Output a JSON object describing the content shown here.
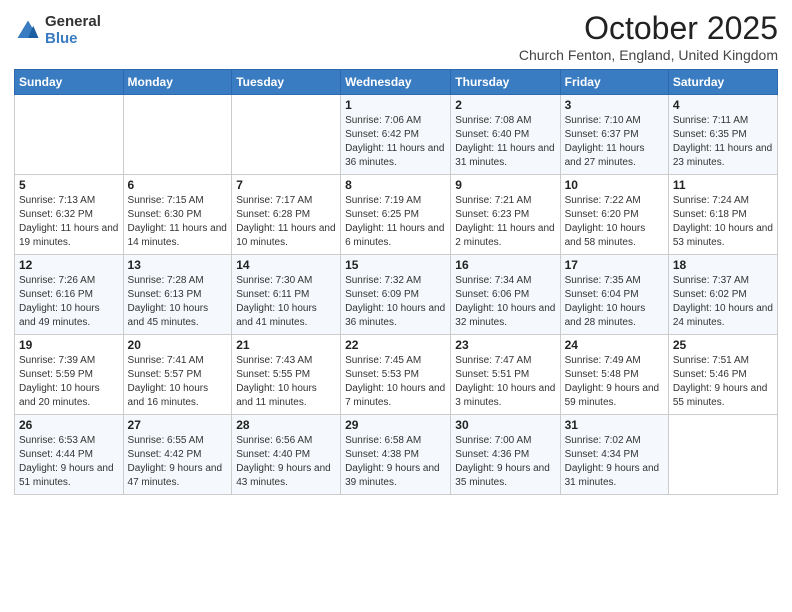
{
  "logo": {
    "general": "General",
    "blue": "Blue"
  },
  "header": {
    "month": "October 2025",
    "location": "Church Fenton, England, United Kingdom"
  },
  "weekdays": [
    "Sunday",
    "Monday",
    "Tuesday",
    "Wednesday",
    "Thursday",
    "Friday",
    "Saturday"
  ],
  "weeks": [
    [
      {
        "day": "",
        "info": ""
      },
      {
        "day": "",
        "info": ""
      },
      {
        "day": "",
        "info": ""
      },
      {
        "day": "1",
        "info": "Sunrise: 7:06 AM\nSunset: 6:42 PM\nDaylight: 11 hours and 36 minutes."
      },
      {
        "day": "2",
        "info": "Sunrise: 7:08 AM\nSunset: 6:40 PM\nDaylight: 11 hours and 31 minutes."
      },
      {
        "day": "3",
        "info": "Sunrise: 7:10 AM\nSunset: 6:37 PM\nDaylight: 11 hours and 27 minutes."
      },
      {
        "day": "4",
        "info": "Sunrise: 7:11 AM\nSunset: 6:35 PM\nDaylight: 11 hours and 23 minutes."
      }
    ],
    [
      {
        "day": "5",
        "info": "Sunrise: 7:13 AM\nSunset: 6:32 PM\nDaylight: 11 hours and 19 minutes."
      },
      {
        "day": "6",
        "info": "Sunrise: 7:15 AM\nSunset: 6:30 PM\nDaylight: 11 hours and 14 minutes."
      },
      {
        "day": "7",
        "info": "Sunrise: 7:17 AM\nSunset: 6:28 PM\nDaylight: 11 hours and 10 minutes."
      },
      {
        "day": "8",
        "info": "Sunrise: 7:19 AM\nSunset: 6:25 PM\nDaylight: 11 hours and 6 minutes."
      },
      {
        "day": "9",
        "info": "Sunrise: 7:21 AM\nSunset: 6:23 PM\nDaylight: 11 hours and 2 minutes."
      },
      {
        "day": "10",
        "info": "Sunrise: 7:22 AM\nSunset: 6:20 PM\nDaylight: 10 hours and 58 minutes."
      },
      {
        "day": "11",
        "info": "Sunrise: 7:24 AM\nSunset: 6:18 PM\nDaylight: 10 hours and 53 minutes."
      }
    ],
    [
      {
        "day": "12",
        "info": "Sunrise: 7:26 AM\nSunset: 6:16 PM\nDaylight: 10 hours and 49 minutes."
      },
      {
        "day": "13",
        "info": "Sunrise: 7:28 AM\nSunset: 6:13 PM\nDaylight: 10 hours and 45 minutes."
      },
      {
        "day": "14",
        "info": "Sunrise: 7:30 AM\nSunset: 6:11 PM\nDaylight: 10 hours and 41 minutes."
      },
      {
        "day": "15",
        "info": "Sunrise: 7:32 AM\nSunset: 6:09 PM\nDaylight: 10 hours and 36 minutes."
      },
      {
        "day": "16",
        "info": "Sunrise: 7:34 AM\nSunset: 6:06 PM\nDaylight: 10 hours and 32 minutes."
      },
      {
        "day": "17",
        "info": "Sunrise: 7:35 AM\nSunset: 6:04 PM\nDaylight: 10 hours and 28 minutes."
      },
      {
        "day": "18",
        "info": "Sunrise: 7:37 AM\nSunset: 6:02 PM\nDaylight: 10 hours and 24 minutes."
      }
    ],
    [
      {
        "day": "19",
        "info": "Sunrise: 7:39 AM\nSunset: 5:59 PM\nDaylight: 10 hours and 20 minutes."
      },
      {
        "day": "20",
        "info": "Sunrise: 7:41 AM\nSunset: 5:57 PM\nDaylight: 10 hours and 16 minutes."
      },
      {
        "day": "21",
        "info": "Sunrise: 7:43 AM\nSunset: 5:55 PM\nDaylight: 10 hours and 11 minutes."
      },
      {
        "day": "22",
        "info": "Sunrise: 7:45 AM\nSunset: 5:53 PM\nDaylight: 10 hours and 7 minutes."
      },
      {
        "day": "23",
        "info": "Sunrise: 7:47 AM\nSunset: 5:51 PM\nDaylight: 10 hours and 3 minutes."
      },
      {
        "day": "24",
        "info": "Sunrise: 7:49 AM\nSunset: 5:48 PM\nDaylight: 9 hours and 59 minutes."
      },
      {
        "day": "25",
        "info": "Sunrise: 7:51 AM\nSunset: 5:46 PM\nDaylight: 9 hours and 55 minutes."
      }
    ],
    [
      {
        "day": "26",
        "info": "Sunrise: 6:53 AM\nSunset: 4:44 PM\nDaylight: 9 hours and 51 minutes."
      },
      {
        "day": "27",
        "info": "Sunrise: 6:55 AM\nSunset: 4:42 PM\nDaylight: 9 hours and 47 minutes."
      },
      {
        "day": "28",
        "info": "Sunrise: 6:56 AM\nSunset: 4:40 PM\nDaylight: 9 hours and 43 minutes."
      },
      {
        "day": "29",
        "info": "Sunrise: 6:58 AM\nSunset: 4:38 PM\nDaylight: 9 hours and 39 minutes."
      },
      {
        "day": "30",
        "info": "Sunrise: 7:00 AM\nSunset: 4:36 PM\nDaylight: 9 hours and 35 minutes."
      },
      {
        "day": "31",
        "info": "Sunrise: 7:02 AM\nSunset: 4:34 PM\nDaylight: 9 hours and 31 minutes."
      },
      {
        "day": "",
        "info": ""
      }
    ]
  ]
}
